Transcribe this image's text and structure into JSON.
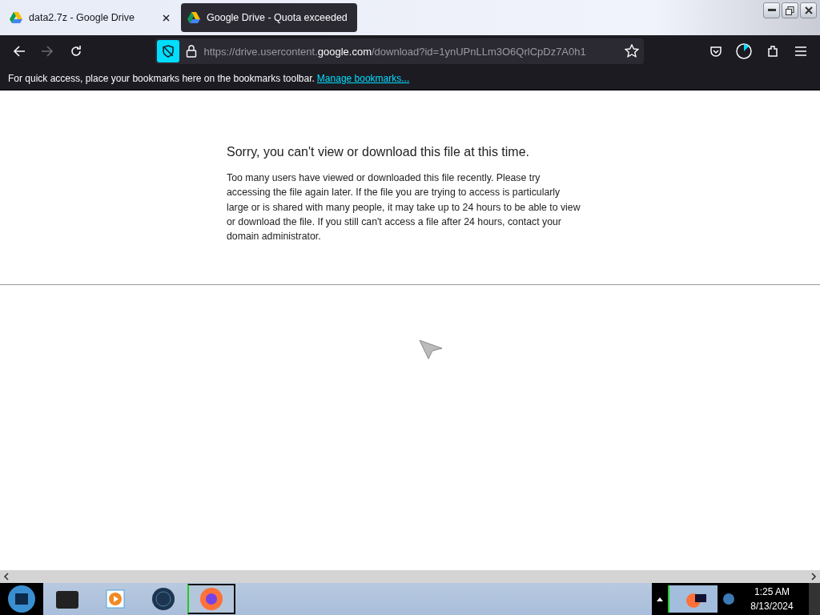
{
  "tabs": [
    {
      "title": "data2.7z - Google Drive",
      "selected": false
    },
    {
      "title": "Google Drive - Quota exceeded",
      "selected": true
    }
  ],
  "url": {
    "before": "https://drive.usercontent.",
    "domain": "google.com",
    "after": "/download?id=1ynUPnLLm3O6QrlCpDz7A0h1"
  },
  "bookmarks_bar": {
    "message": "For quick access, place your bookmarks here on the bookmarks toolbar.",
    "link": "Manage bookmarks..."
  },
  "page": {
    "heading": "Sorry, you can't view or download this file at this time.",
    "body": "Too many users have viewed or downloaded this file recently. Please try accessing the file again later. If the file you are trying to access is particularly large or is shared with many people, it may take up to 24 hours to be able to view or download the file. If you still can't access a file after 24 hours, contact your domain administrator."
  },
  "taskbar": {
    "apps": [
      {
        "kind": "drive",
        "selected": false
      },
      {
        "kind": "media",
        "selected": false
      },
      {
        "kind": "globe",
        "selected": false
      },
      {
        "kind": "firefox",
        "selected": true
      }
    ],
    "time": "1:25 AM",
    "date": "8/13/2024"
  }
}
